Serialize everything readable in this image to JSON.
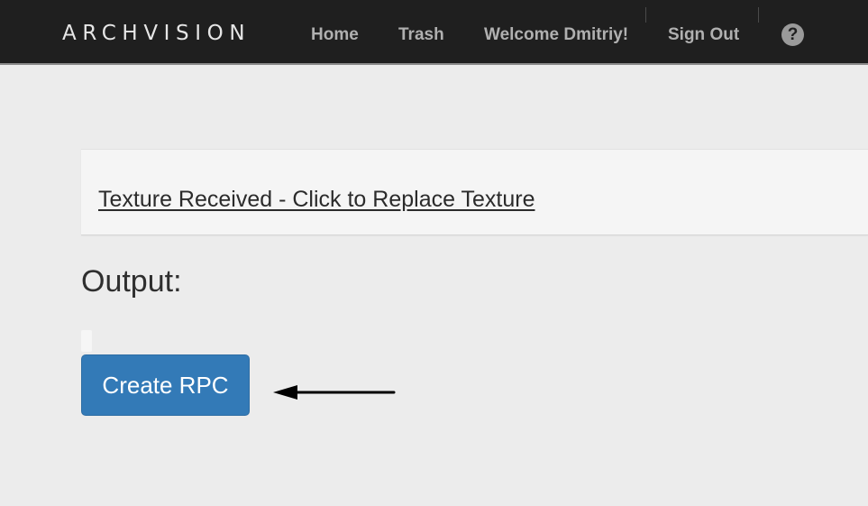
{
  "navbar": {
    "logo": "ARCHVISION",
    "links": {
      "home": "Home",
      "trash": "Trash",
      "welcome": "Welcome Dmitriy!",
      "sign_out": "Sign Out"
    },
    "help_icon": "question-circle-icon",
    "help_glyph": "?"
  },
  "texture": {
    "link_text": "Texture Received - Click to Replace Texture"
  },
  "output": {
    "heading": "Output:"
  },
  "actions": {
    "create_rpc_label": "Create RPC"
  },
  "colors": {
    "navbar_bg": "#1f1f1f",
    "page_bg": "#ececec",
    "primary_button": "#337ab7"
  }
}
